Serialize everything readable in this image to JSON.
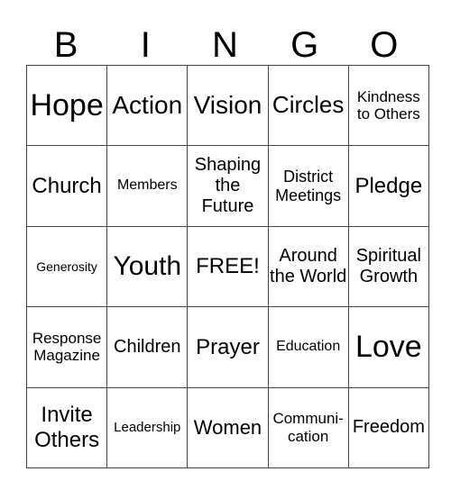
{
  "header": {
    "letters": [
      "B",
      "I",
      "N",
      "G",
      "O"
    ]
  },
  "grid": {
    "rows": [
      [
        "Hope",
        "Action",
        "Vision",
        "Circles",
        "Kindness to Others"
      ],
      [
        "Church",
        "Members",
        "Shaping the Future",
        "District Meetings",
        "Pledge"
      ],
      [
        "Generosity",
        "Youth",
        "FREE!",
        "Around the World",
        "Spiritual Growth"
      ],
      [
        "Response Magazine",
        "Children",
        "Prayer",
        "Education",
        "Love"
      ],
      [
        "Invite Others",
        "Leadership",
        "Women",
        "Communi-cation",
        "Freedom"
      ]
    ]
  }
}
